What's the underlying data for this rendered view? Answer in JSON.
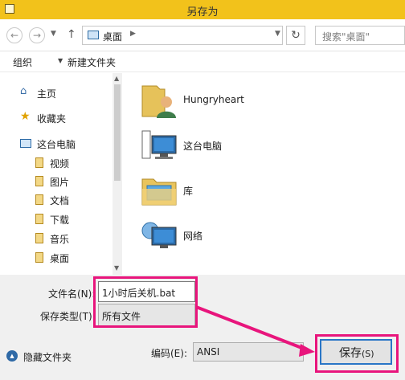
{
  "window": {
    "title": "另存为"
  },
  "address": {
    "location": "桌面",
    "search_placeholder": "搜索\"桌面\""
  },
  "toolbar": {
    "organize": "组织",
    "new_folder": "新建文件夹"
  },
  "nav_pane": {
    "items": [
      {
        "label": "主页",
        "icon": "home-icon"
      },
      {
        "label": "收藏夹",
        "icon": "star-icon"
      },
      {
        "label": "这台电脑",
        "icon": "computer-icon"
      },
      {
        "label": "视频",
        "icon": "library-icon"
      },
      {
        "label": "图片",
        "icon": "library-icon"
      },
      {
        "label": "文档",
        "icon": "library-icon"
      },
      {
        "label": "下载",
        "icon": "library-icon"
      },
      {
        "label": "音乐",
        "icon": "library-icon"
      },
      {
        "label": "桌面",
        "icon": "library-icon"
      }
    ]
  },
  "content": {
    "items": [
      {
        "label": "Hungryheart",
        "icon": "user-folder-icon"
      },
      {
        "label": "这台电脑",
        "icon": "computer-icon"
      },
      {
        "label": "库",
        "icon": "libraries-folder-icon"
      },
      {
        "label": "网络",
        "icon": "network-icon"
      }
    ]
  },
  "form": {
    "filename_label": "文件名(N):",
    "filename_value": "1小时后关机.bat",
    "filetype_label": "保存类型(T):",
    "filetype_value": "所有文件",
    "encoding_label": "编码(E):",
    "encoding_value": "ANSI",
    "hide_folders": "隐藏文件夹",
    "save_label": "保存",
    "save_accel": "(S)"
  },
  "colors": {
    "titlebar": "#f2c21b",
    "highlight": "#e8157c",
    "save_border": "#2a76c6"
  }
}
